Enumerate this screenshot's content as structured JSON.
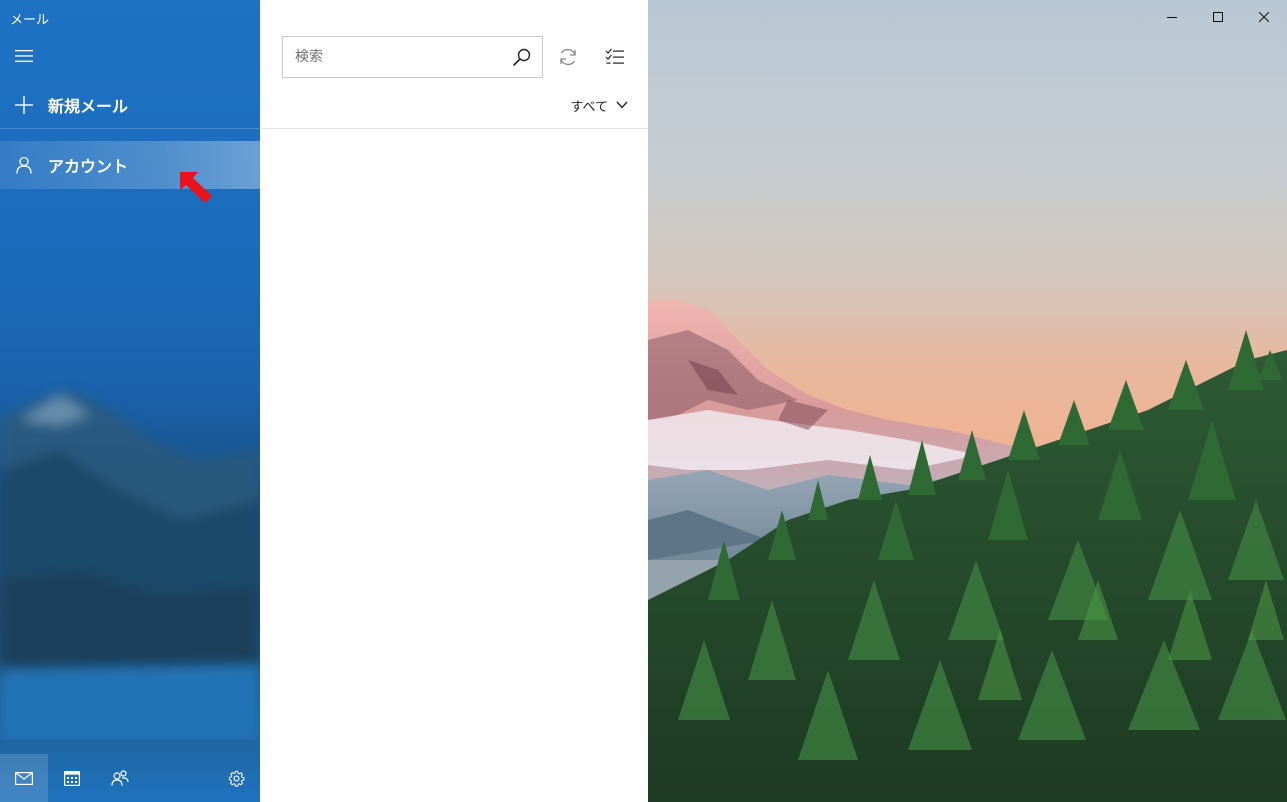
{
  "app": {
    "title": "メール"
  },
  "nav": {
    "new_mail_label": "新規メール",
    "account_label": "アカウント"
  },
  "bottom_bar": {
    "items": [
      "mail-icon",
      "calendar-icon",
      "people-icon",
      "gear-icon"
    ],
    "active": "mail-icon"
  },
  "list": {
    "search_placeholder": "検索",
    "filter_label": "すべて"
  },
  "colors": {
    "nav_blue": "#1f71c4",
    "annotation_arrow": "#e8141b"
  }
}
